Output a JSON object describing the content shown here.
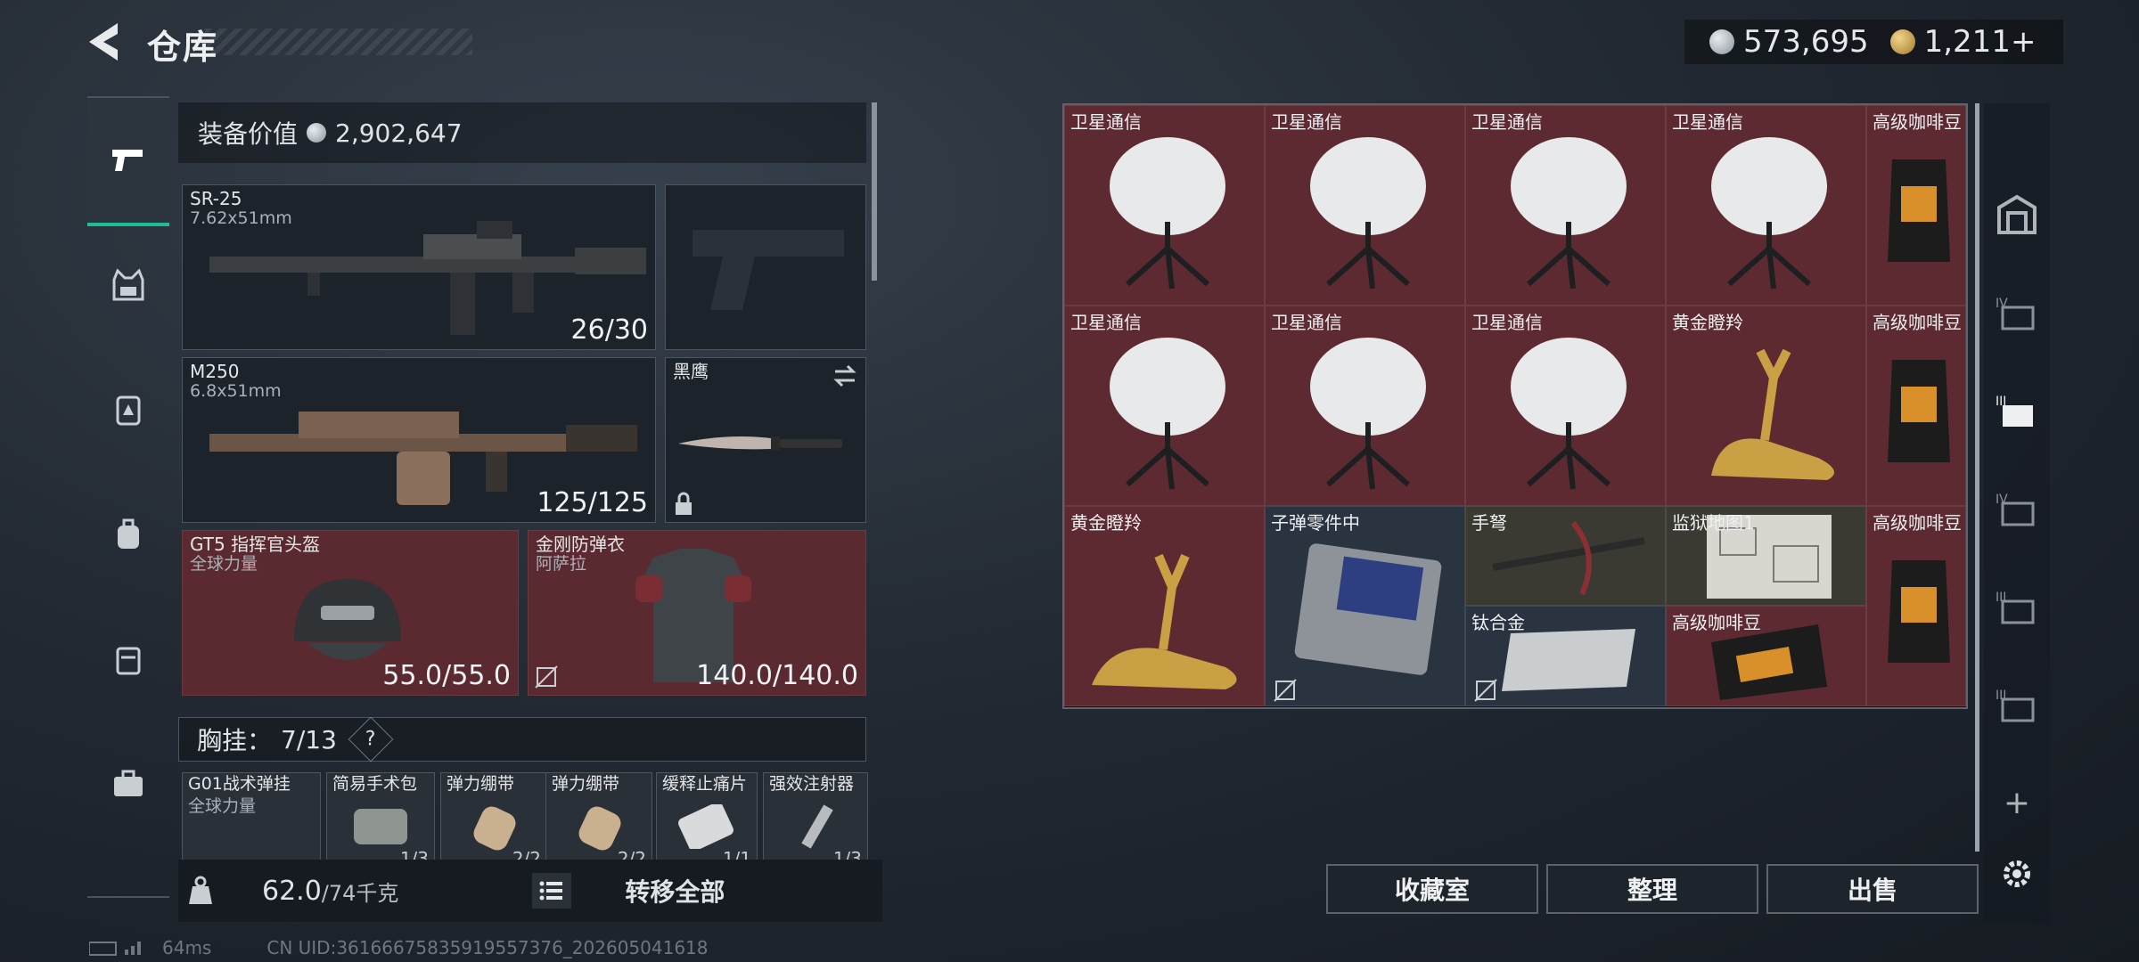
{
  "header": {
    "title": "仓库"
  },
  "currency": {
    "silver": "573,695",
    "gold": "1,211+"
  },
  "equipment": {
    "value_label": "装备价值",
    "value": "2,902,647",
    "primary": {
      "name": "SR-25",
      "caliber": "7.62x51mm",
      "ammo": "26/30"
    },
    "secondary": {
      "name": "M250",
      "caliber": "6.8x51mm",
      "ammo": "125/125"
    },
    "melee": {
      "name": "黑鹰"
    },
    "helmet": {
      "name": "GT5 指挥官头盔",
      "sub": "全球力量",
      "durability": "55.0/55.0"
    },
    "armor": {
      "name": "金刚防弹衣",
      "sub": "阿萨拉",
      "durability": "140.0/140.0"
    },
    "chest_rig": {
      "label": "胸挂：",
      "count": "7/13",
      "help": "?"
    },
    "chest_items": [
      {
        "name": "G01战术弹挂",
        "sub": "全球力量"
      },
      {
        "name": "简易手术包",
        "count": "1/3"
      },
      {
        "name": "弹力绷带",
        "count": "2/2"
      },
      {
        "name": "弹力绷带",
        "count": "2/2"
      },
      {
        "name": "缓释止痛片",
        "count": "1/1"
      },
      {
        "name": "强效注射器",
        "count": "1/3"
      }
    ],
    "weight": {
      "current": "62.0",
      "max": "/74千克"
    },
    "transfer_all": "转移全部"
  },
  "stash": {
    "cells": [
      {
        "label": "卫星通信"
      },
      {
        "label": "卫星通信"
      },
      {
        "label": "卫星通信"
      },
      {
        "label": "卫星通信"
      },
      {
        "label": "高级咖啡豆"
      },
      {
        "label": "卫星通信"
      },
      {
        "label": "卫星通信"
      },
      {
        "label": "卫星通信"
      },
      {
        "label": "黄金瞪羚"
      },
      {
        "label": "高级咖啡豆"
      },
      {
        "label": "黄金瞪羚"
      },
      {
        "label": "子弹零件中"
      },
      {
        "label": "手弩"
      },
      {
        "label": "监狱地图1"
      },
      {
        "label": "高级咖啡豆"
      },
      {
        "label": "钛合金"
      },
      {
        "label": "高级咖啡豆"
      }
    ]
  },
  "buttons": {
    "collection": "收藏室",
    "sort": "整理",
    "sell": "出售"
  },
  "right_tabs": {
    "plus": "+"
  },
  "status": {
    "ping": "64ms",
    "uid": "CN UID:3616667583591955737​6_202605041618"
  },
  "colors": {
    "accent": "#1bbf96",
    "item_red": "#5d2a31",
    "item_gray": "#2a3340"
  }
}
